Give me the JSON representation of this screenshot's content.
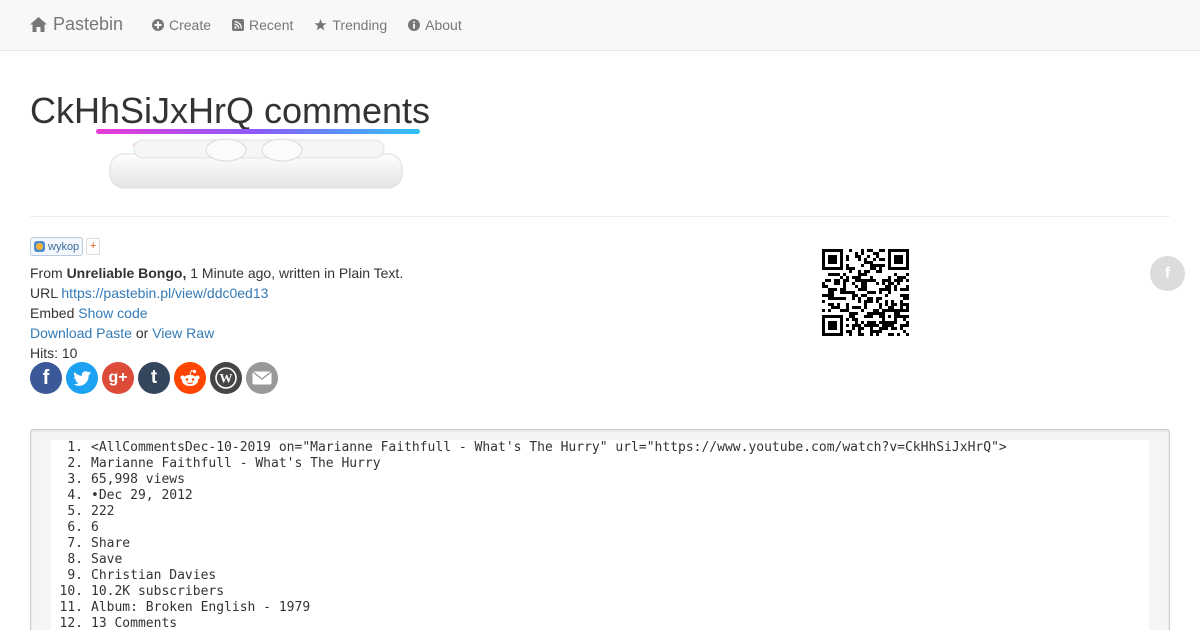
{
  "navbar": {
    "brand": "Pastebin",
    "items": [
      {
        "label": "Create",
        "icon": "plus-circle-icon"
      },
      {
        "label": "Recent",
        "icon": "rss-icon"
      },
      {
        "label": "Trending",
        "icon": "star-icon"
      },
      {
        "label": "About",
        "icon": "info-circle-icon"
      }
    ]
  },
  "page": {
    "title": "CkHhSiJxHrQ comments"
  },
  "share": {
    "wykop_label": "wykop",
    "wykop_plus": "+"
  },
  "meta": {
    "from_prefix": "From ",
    "author": "Unreliable Bongo,",
    "from_suffix": " 1 Minute ago, written in Plain Text.",
    "url_label": "URL ",
    "url": "https://pastebin.pl/view/ddc0ed13",
    "embed_label": "Embed ",
    "embed_link": "Show code",
    "download_link": "Download Paste",
    "or_text": " or ",
    "raw_link": "View Raw",
    "hits": "Hits: 10"
  },
  "socials": [
    {
      "name": "facebook-share-button",
      "glyph": "f",
      "color": "#3b5998"
    },
    {
      "name": "twitter-share-button",
      "glyph": "t",
      "color": "#1da1f2"
    },
    {
      "name": "google-plus-share-button",
      "glyph": "g+",
      "color": "#dd4b39"
    },
    {
      "name": "tumblr-share-button",
      "glyph": "t",
      "color": "#35465c"
    },
    {
      "name": "reddit-share-button",
      "glyph": "r",
      "color": "#ff4500"
    },
    {
      "name": "wordpress-share-button",
      "glyph": "W",
      "color": "#464646"
    },
    {
      "name": "email-share-button",
      "glyph": "✉",
      "color": "#999999"
    }
  ],
  "floating_fb": {
    "glyph": "f"
  },
  "code_lines": [
    {
      "n": "1.",
      "t": "<AllCommentsDec-10-2019 on=\"Marianne Faithfull - What's The Hurry\" url=\"https://www.youtube.com/watch?v=CkHhSiJxHrQ\">"
    },
    {
      "n": "2.",
      "t": "Marianne Faithfull - What's The Hurry"
    },
    {
      "n": "3.",
      "t": "65,998 views"
    },
    {
      "n": "4.",
      "t": "•Dec 29, 2012"
    },
    {
      "n": "5.",
      "t": "222"
    },
    {
      "n": "6.",
      "t": "6"
    },
    {
      "n": "7.",
      "t": "Share"
    },
    {
      "n": "8.",
      "t": "Save"
    },
    {
      "n": "9.",
      "t": "Christian Davies"
    },
    {
      "n": "10.",
      "t": "10.2K subscribers"
    },
    {
      "n": "11.",
      "t": "Album: Broken English - 1979"
    },
    {
      "n": "12.",
      "t": "13 Comments"
    }
  ]
}
